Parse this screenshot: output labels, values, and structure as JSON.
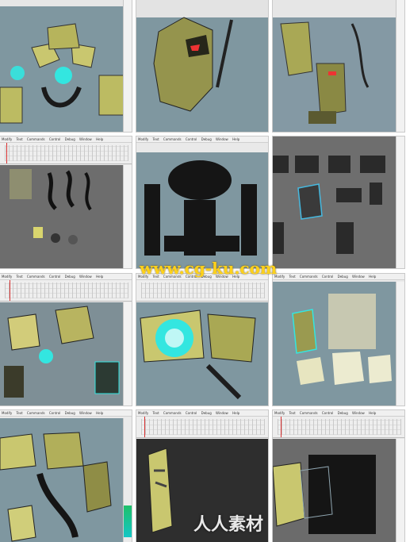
{
  "menu": {
    "items": [
      "Modify",
      "Text",
      "Commands",
      "Control",
      "Debug",
      "Window",
      "Help"
    ]
  },
  "watermarks": {
    "primary": "www.cg-ku.com",
    "secondary": "人人素材"
  },
  "colors": {
    "stage_blue": "#7f97a0",
    "stage_gray": "#6d6d6d",
    "armor_yellow": "#c9c76f",
    "glow_cyan": "#33e6e0",
    "silhouette": "#151515"
  },
  "icons": [
    "robot-armor-illustration",
    "robot-silhouette",
    "glowing-core",
    "armor-parts-layout",
    "timeline-playhead"
  ]
}
